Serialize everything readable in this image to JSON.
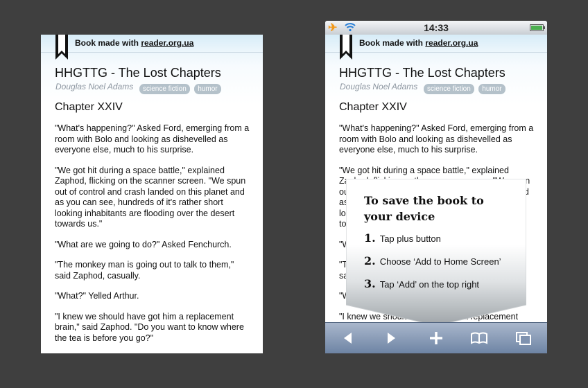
{
  "app": {
    "made_with_prefix": "Book made with",
    "made_with_link": "reader.org.ua"
  },
  "book": {
    "title": "HHGTTG - The Lost Chapters",
    "author": "Douglas Noel Adams",
    "tags": [
      "science fiction",
      "humor"
    ],
    "chapter": "Chapter XXIV",
    "paragraphs": [
      "\"What's happening?\" Asked Ford, emerging from a room with Bolo and looking as dishevelled as everyone else, much to his surprise.",
      "\"We got hit during a space battle,\" explained Zaphod, flicking on the scanner screen. \"We spun out of control and crash landed on this planet and as you can see, hundreds of it's rather short looking inhabitants are flooding over the desert towards us.\"",
      "\"What are we going to do?\" Asked Fenchurch.",
      "\"The monkey man is going out to talk to them,\" said Zaphod, casually.",
      "\"What?\" Yelled Arthur.",
      "\"I knew we should have got him a replacement brain,\" said Zaphod. \"Do you want to know where the tea is before you go?\""
    ]
  },
  "status_bar": {
    "time": "14:33",
    "icons": [
      "airplane-icon",
      "wifi-icon",
      "battery-icon"
    ]
  },
  "popup": {
    "title": "To save the book to your device",
    "steps": [
      {
        "num": "1.",
        "text": "Tap plus button"
      },
      {
        "num": "2.",
        "text": "Choose ‘Add to Home Screen’"
      },
      {
        "num": "3.",
        "text": "Tap ‘Add’ on the top right"
      }
    ]
  },
  "toolbar": {
    "buttons": [
      "back-icon",
      "forward-icon",
      "add-icon",
      "bookmarks-icon",
      "pages-icon"
    ]
  },
  "colors": {
    "background": "#3f3f3f",
    "tag": "#b4c1ca",
    "toolbar": "#8a9cb8",
    "airplane": "#f39a1c",
    "wifi": "#2a7fd6",
    "battery": "#4caf50"
  }
}
